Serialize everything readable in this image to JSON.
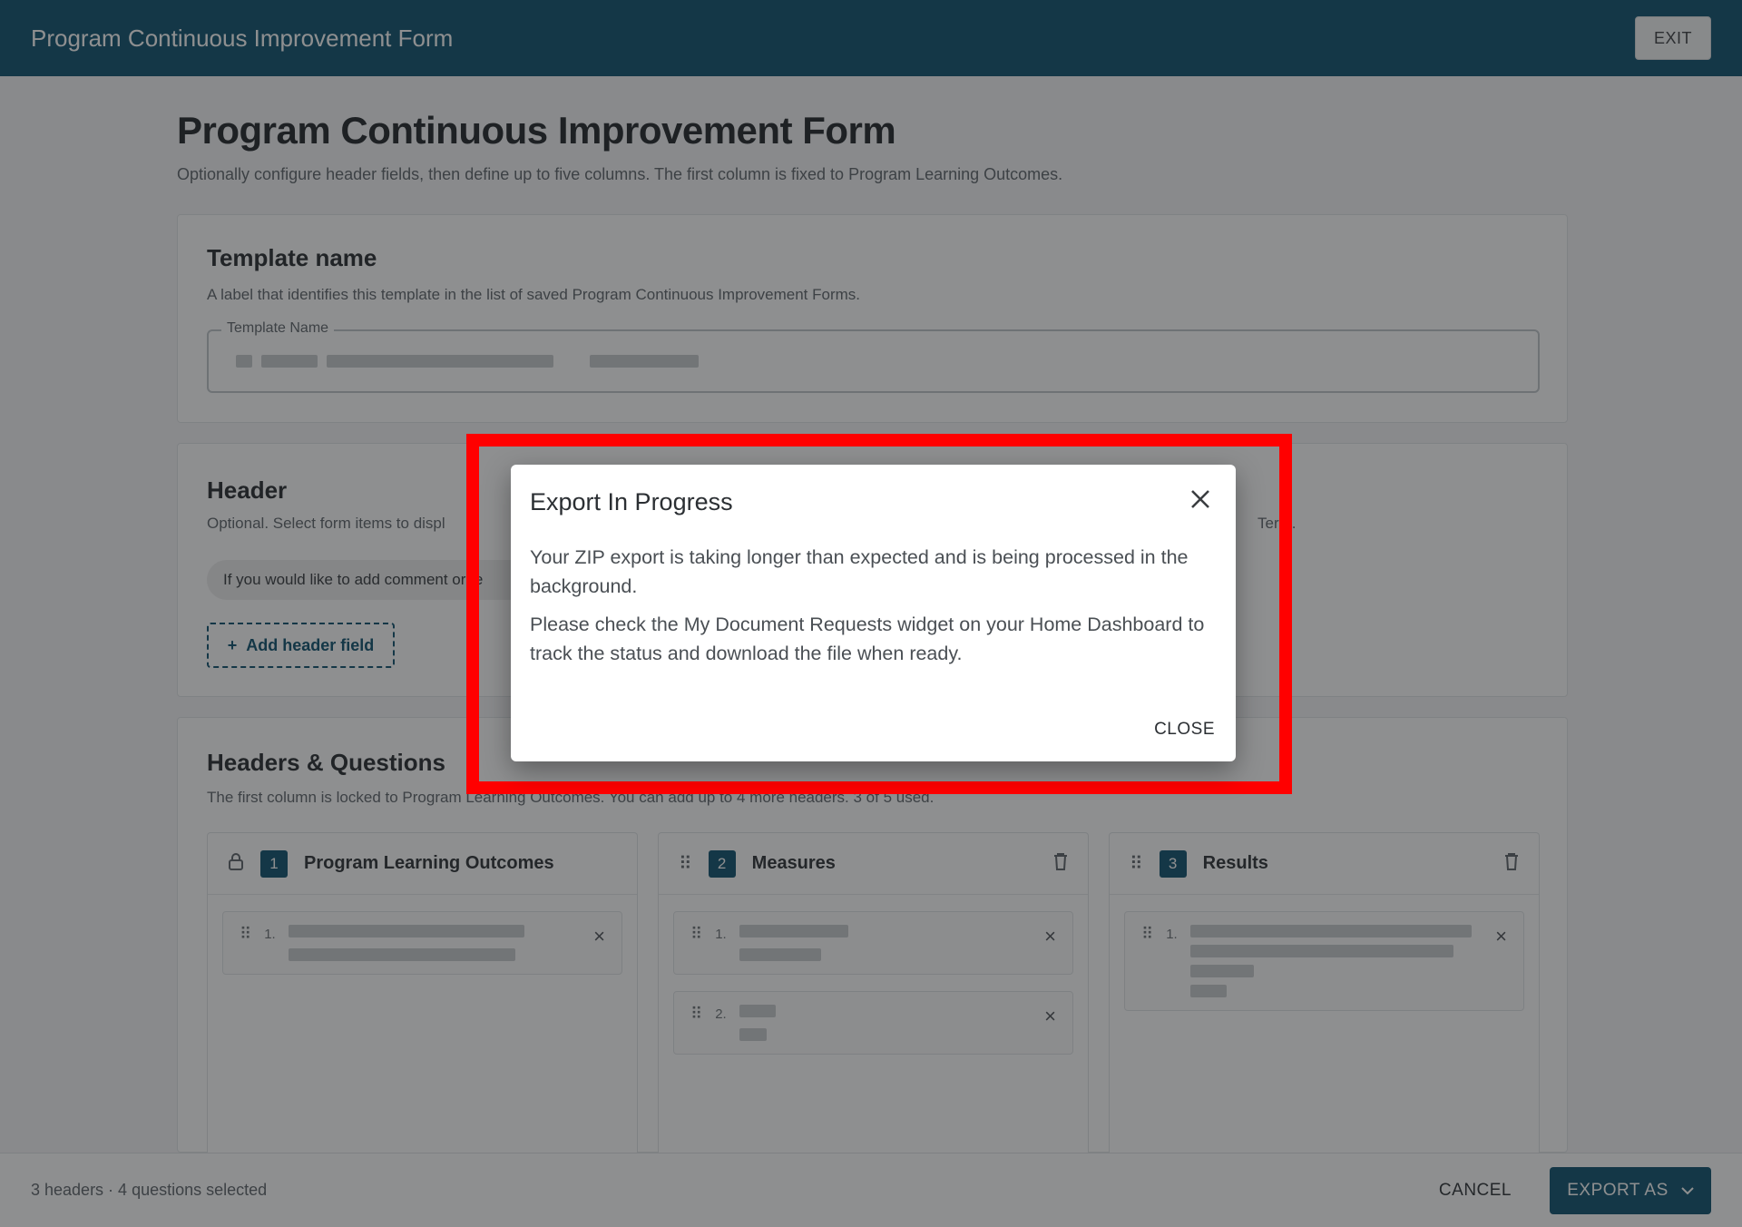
{
  "topbar": {
    "title": "Program Continuous Improvement Form",
    "exit_label": "EXIT"
  },
  "page": {
    "title": "Program Continuous Improvement Form",
    "subtitle": "Optionally configure header fields, then define up to five columns. The first column is fixed to Program Learning Outcomes."
  },
  "template_card": {
    "title": "Template name",
    "description": "A label that identifies this template in the list of saved Program Continuous Improvement Forms.",
    "field_label": "Template Name"
  },
  "header_card": {
    "title": "Header",
    "description_left": "Optional. Select form items to displ",
    "description_right": "Term.",
    "chip_text": "If you would like to add comment or fe",
    "add_button_label": "Add header field",
    "add_icon": "plus-icon"
  },
  "hq_card": {
    "title": "Headers & Questions",
    "description": "The first column is locked to Program Learning Outcomes. You can add up to 4 more headers. 3 of 5 used.",
    "columns": [
      {
        "num": "1",
        "name": "Program Learning Outcomes",
        "lead_icon": "lock-icon"
      },
      {
        "num": "2",
        "name": "Measures",
        "lead_icon": "drag-handle-icon",
        "trail_icon": "trash-icon"
      },
      {
        "num": "3",
        "name": "Results",
        "lead_icon": "drag-handle-icon",
        "trail_icon": "trash-icon"
      }
    ],
    "question_numbers": [
      "1.",
      "1.",
      "2.",
      "1."
    ]
  },
  "bottombar": {
    "status": "3 headers · 4 questions selected",
    "cancel_label": "CANCEL",
    "export_label": "EXPORT AS"
  },
  "dialog": {
    "title": "Export In Progress",
    "paragraph1": "Your ZIP export is taking longer than expected and is being processed in the background.",
    "paragraph2": "Please check the My Document Requests widget on your Home Dashboard to track the status and download the file when ready.",
    "close_label": "CLOSE"
  },
  "colors": {
    "brand": "#0b4f6c",
    "highlight": "#ff0000"
  }
}
